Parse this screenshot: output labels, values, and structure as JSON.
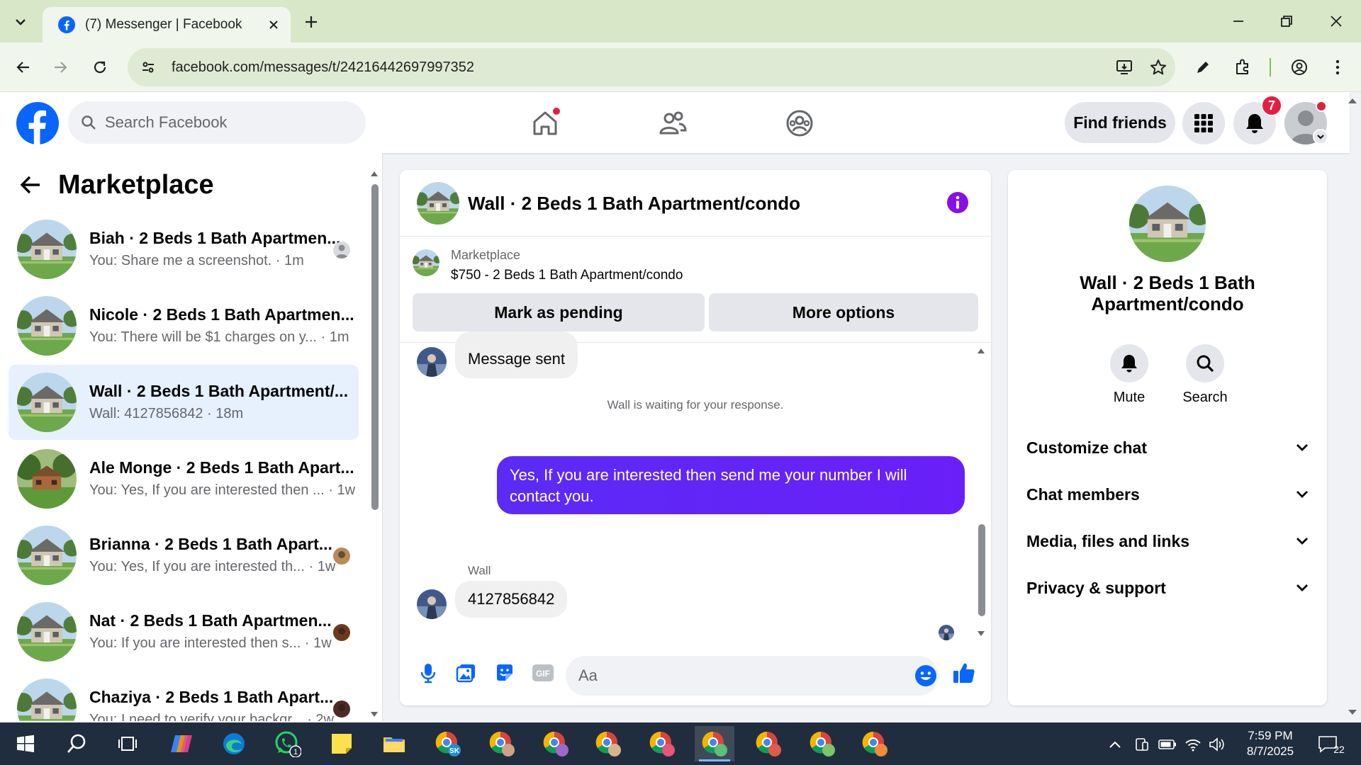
{
  "browser": {
    "tab_title": "(7) Messenger | Facebook",
    "url": "facebook.com/messages/t/24216442697997352"
  },
  "header": {
    "search_placeholder": "Search Facebook",
    "find_friends_label": "Find friends",
    "notification_count": "7"
  },
  "sidebar": {
    "title": "Marketplace",
    "conversations": [
      {
        "name": "Biah · 2 Beds 1 Bath Apartmen...",
        "snippet": "You: Share me a screenshot. · 1m",
        "active": false
      },
      {
        "name": "Nicole · 2 Beds 1 Bath Apartmen...",
        "snippet": "You: There will be $1 charges on y... · 1m",
        "active": false
      },
      {
        "name": "Wall · 2 Beds 1 Bath Apartment/...",
        "snippet": "Wall: 4127856842 · 18m",
        "active": true
      },
      {
        "name": "Ale Monge · 2 Beds 1 Bath Apart...",
        "snippet": "You: Yes, If you are interested then ... · 1w",
        "active": false
      },
      {
        "name": "Brianna · 2 Beds 1 Bath Apart...",
        "snippet": "You: Yes, If you are interested th... · 1w",
        "active": false
      },
      {
        "name": "Nat · 2 Beds 1 Bath Apartmen...",
        "snippet": "You: If you are interested then s... · 1w",
        "active": false
      },
      {
        "name": "Chaziya · 2 Beds 1 Bath Apart...",
        "snippet": "You: I need to verify your backgr... · 2w",
        "active": false
      }
    ]
  },
  "chat": {
    "title": "Wall · 2 Beds 1 Bath Apartment/condo",
    "marketplace_label": "Marketplace",
    "listing": "$750 - 2 Beds 1 Bath Apartment/condo",
    "mark_pending_label": "Mark as pending",
    "more_options_label": "More options",
    "messages": {
      "msg1": "Message sent",
      "waiting_notice": "Wall is waiting for your response.",
      "outgoing": "Yes, If you are interested then send me your number I will contact you.",
      "sender": "Wall",
      "incoming": "4127856842"
    },
    "composer_placeholder": "Aa"
  },
  "details": {
    "name": "Wall · 2 Beds 1 Bath Apartment/condo",
    "mute_label": "Mute",
    "search_label": "Search",
    "sections": [
      "Customize chat",
      "Chat members",
      "Media, files and links",
      "Privacy & support"
    ]
  },
  "taskbar": {
    "time": "7:59 PM",
    "date": "8/7/2025",
    "whatsapp_badge": "1",
    "notifications_count": "22"
  },
  "colors": {
    "facebook_blue": "#0866ff",
    "messenger_purple": "#6a1ff8",
    "notification_red": "#e41e3f"
  }
}
